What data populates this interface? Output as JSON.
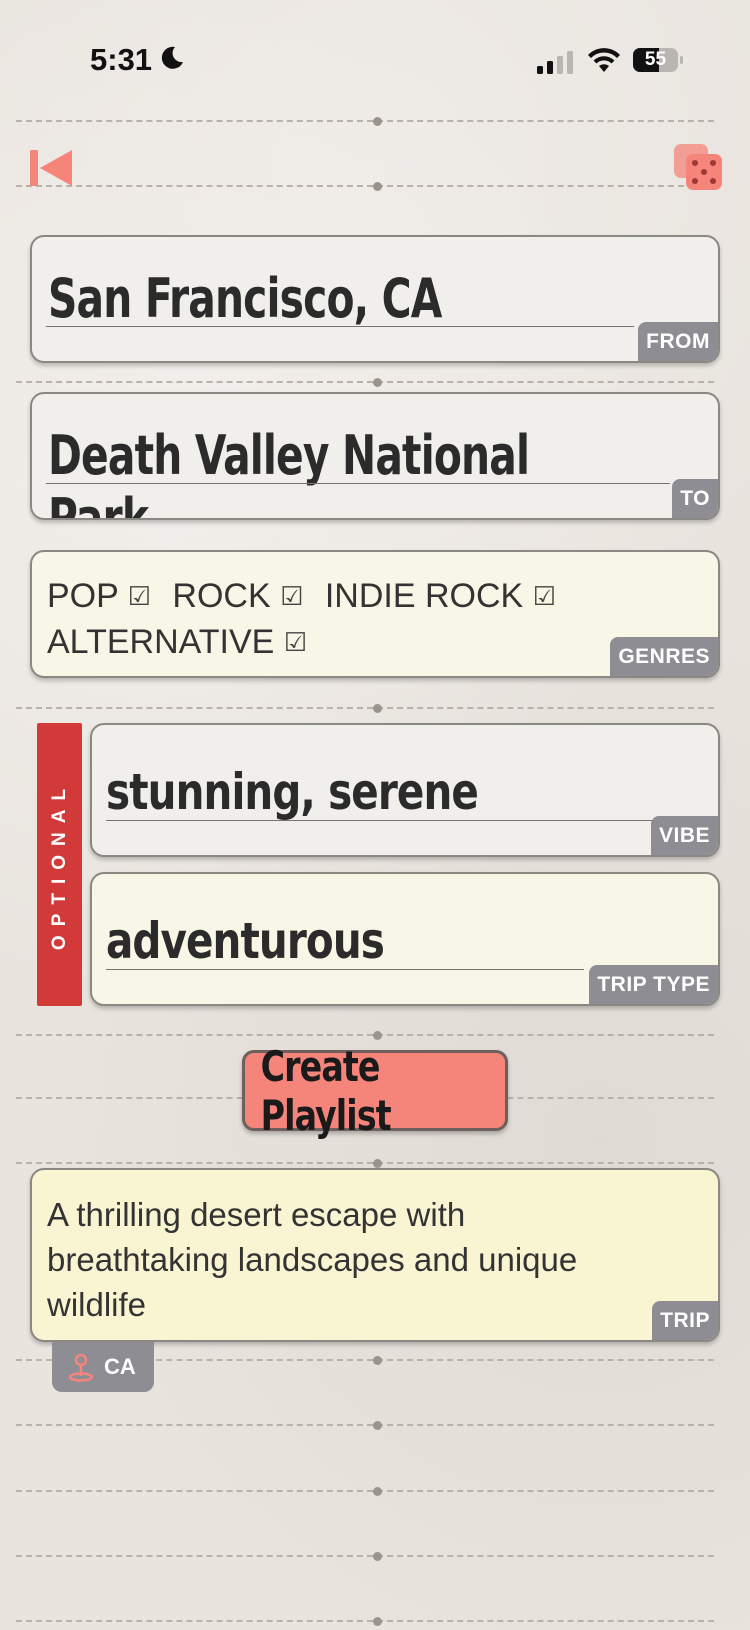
{
  "status_bar": {
    "time": "5:31",
    "battery_level": "55"
  },
  "toolbar": {
    "back_icon": "skip-back-icon",
    "shuffle_icon": "dice-icon",
    "accent_color": "#f5857b"
  },
  "from": {
    "value": "San Francisco, CA",
    "tag": "FROM"
  },
  "to": {
    "value": "Death Valley National Park",
    "tag": "TO"
  },
  "genres": {
    "tag": "GENRES",
    "items": [
      "POP",
      "ROCK",
      "INDIE ROCK",
      "ALTERNATIVE"
    ],
    "check_glyph": "☑"
  },
  "optional": {
    "label": "OPTIONAL",
    "color": "#d13a38"
  },
  "vibe": {
    "value": "stunning, serene",
    "tag": "VIBE"
  },
  "trip_type": {
    "value": "adventurous",
    "tag": "TRIP TYPE"
  },
  "create_button": {
    "label": "Create Playlist"
  },
  "trip": {
    "description": "A thrilling desert escape with breathtaking landscapes and unique wildlife",
    "tag": "TRIP",
    "location_label": "CA"
  }
}
